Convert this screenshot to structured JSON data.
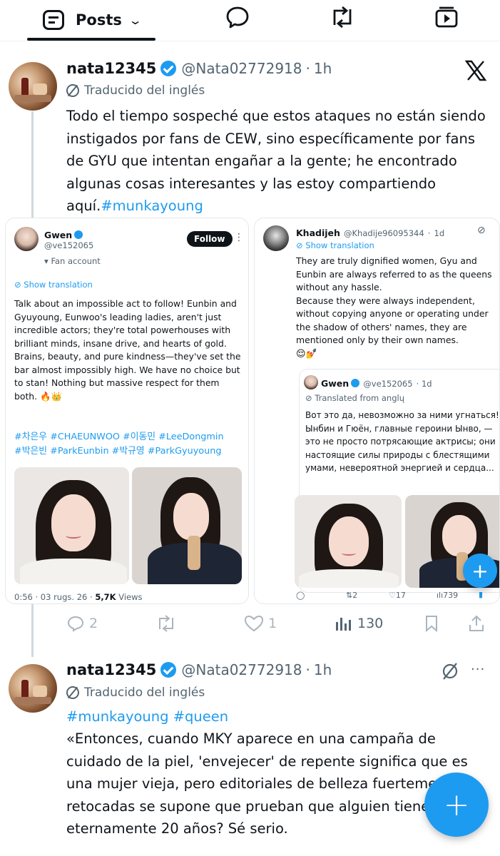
{
  "topbar": {
    "posts_label": "Posts",
    "icons": [
      "posts-icon",
      "chat-bubble-icon",
      "retweet-icon",
      "video-icon"
    ]
  },
  "post1": {
    "username": "nata12345",
    "handle": "@Nata02772918",
    "dot": "·",
    "time": "1h",
    "translated_label": "Traducido del inglés",
    "text_parts": {
      "main": "Todo el tiempo sospeché que estos ataques no están siendo instigados por fans de CEW, sino específicamente por fans de GYU que intentan engañar a la gente; he encontrado algunas cosas interesantes y las estoy compartiendo aquí.",
      "hashtag": "#munkayoung"
    },
    "corner_icon": "x-logo-icon"
  },
  "shot1": {
    "name": "Gwen",
    "handle": "@ve152065",
    "follow": "Follow",
    "fan_account": "Fan account",
    "show_translation": "Show translation",
    "body": "Talk about an impossible act to follow! Eunbin and Gyuyoung, Eunwoo's leading ladies, aren't just incredible actors; they're total powerhouses with brilliant minds, insane drive, and hearts of gold. Brains, beauty, and pure kindness—they've set the bar almost impossibly high. We have no choice but to stan! Nothing but massive respect for them both. 🔥👑",
    "hashtags_line1": "#차은우 #CHAEUNWOO #이동민 #LeeDongmin",
    "hashtags_line2": "#박은빈 #ParkEunbin #박규영 #ParkGyuyoung",
    "meta": "0:56 · 03 rugs. 26 ·",
    "views": "5,7K",
    "views_label": "Views"
  },
  "shot2": {
    "name": "Khadijeh",
    "handle": "@Khadije96095344",
    "dot": "·",
    "time": "1d",
    "show_translation": "Show translation",
    "body": "They are truly dignified women, Gyu and Eunbin are always referred to as the queens without any hassle.\nBecause they were always independent, without copying anyone or operating under the shadow of others' names, they are mentioned only by their own names.",
    "emoji": "😌💅",
    "quote": {
      "name": "Gwen",
      "handle": "@ve152065",
      "time": "· 1d",
      "translated": "Translated from anglų",
      "body": "Вот это да, невозможно за ними угнаться! Ынбин и Гюён, главные героини Ынво, — это не просто потрясающие актрисы; они настоящие силы природы с блестящими умами, невероятной энергией и сердца..."
    },
    "stats": {
      "retweets": "2",
      "likes": "17",
      "views": "739"
    }
  },
  "post1_actions": {
    "replies": "2",
    "likes": "1",
    "views": "130"
  },
  "post2": {
    "username": "nata12345",
    "handle": "@Nata02772918",
    "dot": "·",
    "time": "1h",
    "translated_label": "Traducido del inglés",
    "hashtags": "#munkayoung #queen",
    "body": "«Entonces, cuando MKY aparece en una campaña de cuidado de la piel, 'envejecer' de repente significa que es una mujer vieja, pero editoriales de belleza fuertemente retocadas se supone que prueban que alguien tiene eternamente 20 años? Sé serio.",
    "more": "···"
  },
  "colors": {
    "accent": "#1d9bf0",
    "text": "#0f1419",
    "muted": "#536471"
  }
}
